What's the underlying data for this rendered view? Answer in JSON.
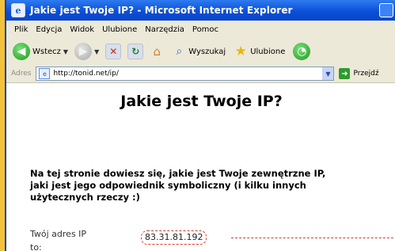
{
  "window": {
    "title": "Jakie jest Twoje IP? - Microsoft Internet Explorer"
  },
  "menu": [
    "Plik",
    "Edycja",
    "Widok",
    "Ulubione",
    "Narzędzia",
    "Pomoc"
  ],
  "toolbar": {
    "back_label": "Wstecz",
    "search_label": "Wyszukaj",
    "favorites_label": "Ulubione"
  },
  "address": {
    "label": "Adres",
    "url": "http://tonid.net/ip/",
    "go_label": "Przejdź"
  },
  "page": {
    "heading": "Jakie jest Twoje IP?",
    "intro_lines": [
      "Na tej stronie dowiesz się, jakie jest Twoje zewnętrzne IP,",
      "jaki jest jego odpowiednik symboliczny (i kilku innych",
      "użytecznych rzeczy :)"
    ],
    "ip_label_line1": "Twój adres IP",
    "ip_label_line2": "to:",
    "ip_value": "83.31.81.192"
  }
}
